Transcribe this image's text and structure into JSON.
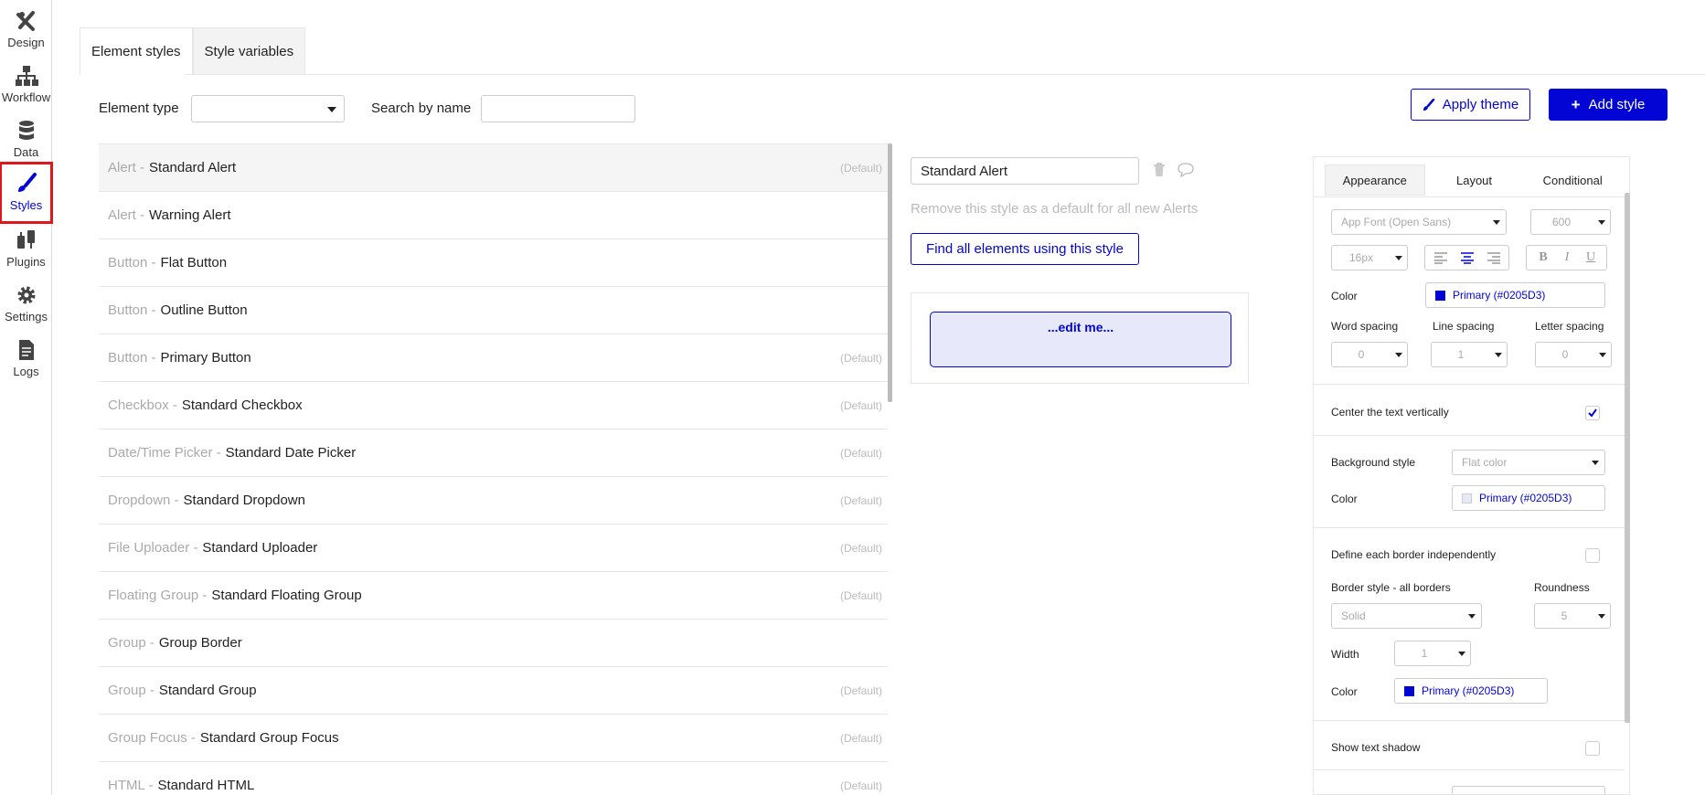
{
  "rail": {
    "items": [
      {
        "label": "Design",
        "icon": "design-icon"
      },
      {
        "label": "Workflow",
        "icon": "workflow-icon"
      },
      {
        "label": "Data",
        "icon": "database-icon"
      },
      {
        "label": "Styles",
        "icon": "brush-icon"
      },
      {
        "label": "Plugins",
        "icon": "plug-icon"
      },
      {
        "label": "Settings",
        "icon": "gear-icon"
      },
      {
        "label": "Logs",
        "icon": "document-icon"
      }
    ],
    "active": "Styles",
    "highlight_color": "#e0161b"
  },
  "tabs": {
    "element_styles": "Element styles",
    "style_variables": "Style variables"
  },
  "filters": {
    "element_type_label": "Element type",
    "element_type_value": "",
    "search_label": "Search by name",
    "search_value": ""
  },
  "actions": {
    "apply_theme": "Apply theme",
    "add_style": "Add style"
  },
  "style_list": [
    {
      "type": "Alert - ",
      "name": "Standard Alert",
      "default": "(Default)"
    },
    {
      "type": "Alert - ",
      "name": "Warning Alert",
      "default": ""
    },
    {
      "type": "Button - ",
      "name": "Flat Button",
      "default": ""
    },
    {
      "type": "Button - ",
      "name": "Outline Button",
      "default": ""
    },
    {
      "type": "Button - ",
      "name": "Primary Button",
      "default": "(Default)"
    },
    {
      "type": "Checkbox - ",
      "name": "Standard Checkbox",
      "default": "(Default)"
    },
    {
      "type": "Date/Time Picker - ",
      "name": "Standard Date Picker",
      "default": "(Default)"
    },
    {
      "type": "Dropdown - ",
      "name": "Standard Dropdown",
      "default": "(Default)"
    },
    {
      "type": "File Uploader - ",
      "name": "Standard Uploader",
      "default": "(Default)"
    },
    {
      "type": "Floating Group - ",
      "name": "Standard Floating Group",
      "default": "(Default)"
    },
    {
      "type": "Group - ",
      "name": "Group Border",
      "default": ""
    },
    {
      "type": "Group - ",
      "name": "Standard Group",
      "default": "(Default)"
    },
    {
      "type": "Group Focus - ",
      "name": "Standard Group Focus",
      "default": "(Default)"
    },
    {
      "type": "HTML - ",
      "name": "Standard HTML",
      "default": "(Default)"
    }
  ],
  "editor": {
    "style_name": "Standard Alert",
    "hint": "Remove this style as a default for all new Alerts",
    "find_button": "Find all elements using this style",
    "preview_text": "...edit me..."
  },
  "props": {
    "tabs": [
      "Appearance",
      "Layout",
      "Conditional"
    ],
    "active_tab": "Appearance",
    "font": "App Font (Open Sans)",
    "font_weight": "600",
    "font_size": "16px",
    "color_label": "Color",
    "color_value": "Primary (#0205D3)",
    "word_spacing_label": "Word spacing",
    "line_spacing_label": "Line spacing",
    "letter_spacing_label": "Letter spacing",
    "word_spacing": "0",
    "line_spacing": "1",
    "letter_spacing": "0",
    "center_vertically_label": "Center the text vertically",
    "center_vertically": true,
    "bg_style_label": "Background style",
    "bg_style": "Flat color",
    "bg_color_label": "Color",
    "bg_color": "Primary (#0205D3)",
    "border_independent_label": "Define each border independently",
    "border_style_label": "Border style - all borders",
    "roundness_label": "Roundness",
    "border_style": "Solid",
    "roundness": "5",
    "width_label": "Width",
    "width": "1",
    "border_color_label": "Color",
    "border_color": "Primary (#0205D3)",
    "text_shadow_label": "Show text shadow",
    "primary_color": "#0205d3"
  }
}
